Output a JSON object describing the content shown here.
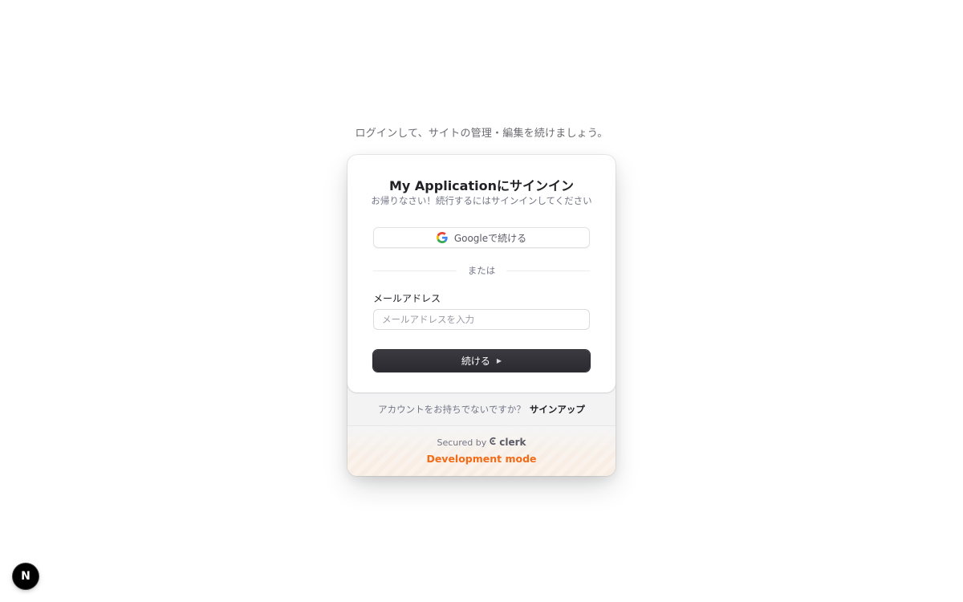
{
  "intro_text": "ログインして、サイトの管理・編集を続けましょう。",
  "card": {
    "title": "My Applicationにサインイン",
    "subtitle": "お帰りなさい！続行するにはサインインしてください",
    "google_button_label": "Googleで続ける",
    "divider_text": "または",
    "email": {
      "label": "メールアドレス",
      "placeholder": "メールアドレスを入力",
      "value": ""
    },
    "continue_label": "続ける"
  },
  "signup": {
    "prompt": "アカウントをお持ちでないですか？",
    "link_label": "サインアップ"
  },
  "footer": {
    "secured_by": "Secured by",
    "brand": "clerk",
    "dev_mode": "Development mode"
  },
  "nextjs_badge": {
    "letter": "N"
  },
  "colors": {
    "accent": "#f36b16",
    "primary_button": "#2f2f35",
    "text": "#212126",
    "muted": "#747686"
  },
  "icons": [
    "google-icon",
    "play-arrow-icon",
    "clerk-logo-icon",
    "nextjs-icon"
  ]
}
